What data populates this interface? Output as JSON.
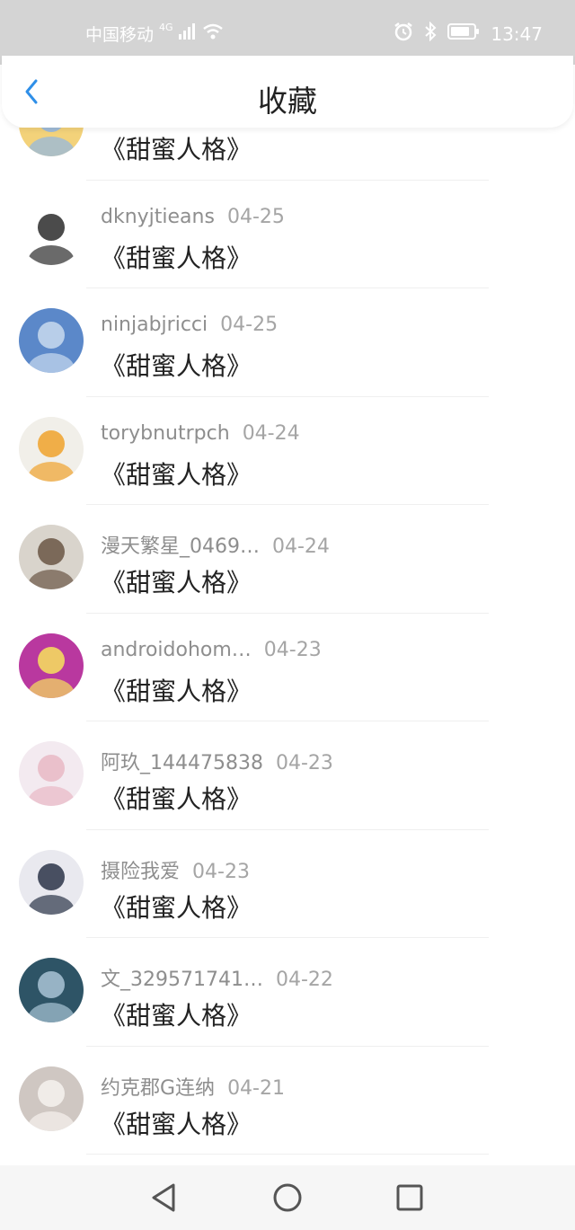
{
  "status_bar": {
    "carrier": "中国移动",
    "network": "4G",
    "time": "13:47"
  },
  "header": {
    "title": "收藏"
  },
  "items": [
    {
      "name": "",
      "date": "",
      "book": "《甜蜜人格》",
      "avatar_colors": [
        "#f3d27a",
        "#8fb6e6"
      ]
    },
    {
      "name": "dknyjtieans",
      "date": "04-25",
      "book": "《甜蜜人格》",
      "avatar_colors": [
        "#ffffff",
        "#2b2b2b"
      ]
    },
    {
      "name": "ninjabjricci",
      "date": "04-25",
      "book": "《甜蜜人格》",
      "avatar_colors": [
        "#5b88c9",
        "#c9dbef"
      ]
    },
    {
      "name": "torybnutrpch",
      "date": "04-24",
      "book": "《甜蜜人格》",
      "avatar_colors": [
        "#f1efe9",
        "#f0a22c"
      ]
    },
    {
      "name": "漫天繁星_0469…",
      "date": "04-24",
      "book": "《甜蜜人格》",
      "avatar_colors": [
        "#d9d4cc",
        "#6a5644"
      ]
    },
    {
      "name": "androidohom…",
      "date": "04-23",
      "book": "《甜蜜人格》",
      "avatar_colors": [
        "#b9389f",
        "#f7e35c"
      ]
    },
    {
      "name": "阿玖_144475838",
      "date": "04-23",
      "book": "《甜蜜人格》",
      "avatar_colors": [
        "#f3eaf0",
        "#e8b8c4"
      ]
    },
    {
      "name": "摄险我爱",
      "date": "04-23",
      "book": "《甜蜜人格》",
      "avatar_colors": [
        "#e9e9ef",
        "#2b3448"
      ]
    },
    {
      "name": "文_329571741…",
      "date": "04-22",
      "book": "《甜蜜人格》",
      "avatar_colors": [
        "#2e5466",
        "#a9c4d6"
      ]
    },
    {
      "name": "约克郡G连纳",
      "date": "04-21",
      "book": "《甜蜜人格》",
      "avatar_colors": [
        "#cfc7c2",
        "#f6f2ee"
      ]
    }
  ]
}
